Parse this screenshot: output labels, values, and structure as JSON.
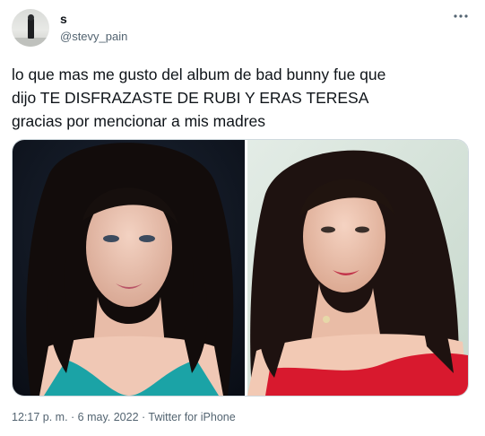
{
  "user": {
    "name": "s",
    "handle": "@stevy_pain"
  },
  "tweet": {
    "lines": [
      "lo que mas me gusto del album de bad bunny fue que",
      "dijo TE DISFRAZASTE DE RUBI Y ERAS TERESA",
      "gracias por mencionar a mis madres"
    ]
  },
  "media": {
    "photos": [
      {
        "subject": "woman-dark-hair-teal-top"
      },
      {
        "subject": "woman-dark-hair-red-dress"
      }
    ]
  },
  "meta": {
    "time": "12:17 p. m.",
    "sep1": " · ",
    "date": "6 may. 2022",
    "sep2": " · ",
    "source": "Twitter for iPhone"
  },
  "icons": {
    "more": "more-options-icon"
  },
  "colors": {
    "text_primary": "#0f1419",
    "text_secondary": "#536471",
    "border": "#cfd9de"
  }
}
